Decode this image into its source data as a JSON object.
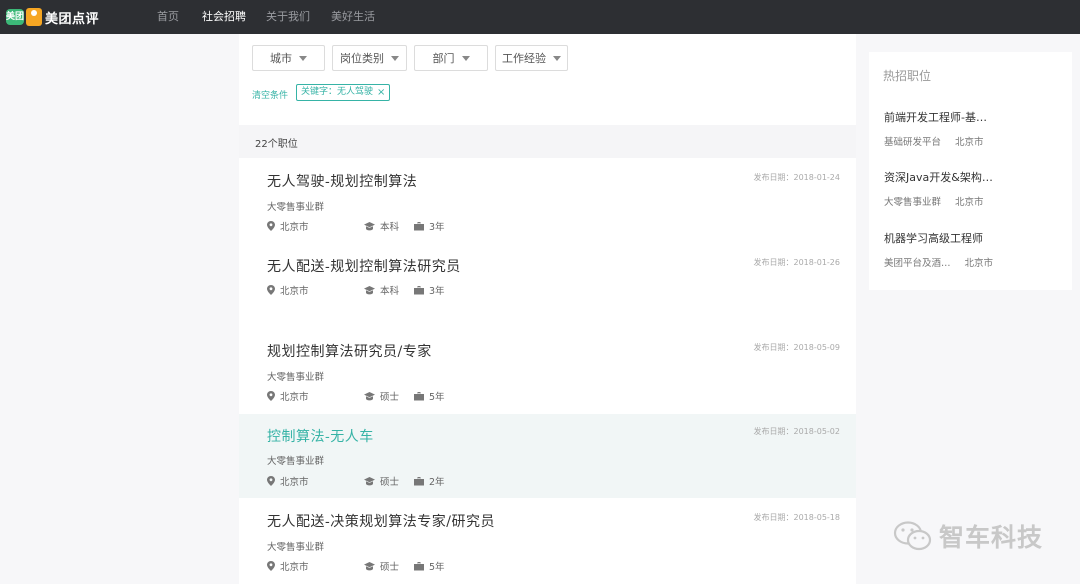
{
  "brand": {
    "badge": "美团",
    "name": "美团点评"
  },
  "nav": [
    "首页",
    "社会招聘",
    "关于我们",
    "美好生活"
  ],
  "filters": [
    "城市",
    "岗位类别",
    "部门",
    "工作经验"
  ],
  "clear_label": "清空条件",
  "keyword_tag": "关键字：无人驾驶",
  "tag_close": "×",
  "result_count": "22个职位",
  "jobs": [
    {
      "title": "无人驾驶-规划控制算法",
      "dept": "大零售事业群",
      "city": "北京市",
      "edu": "本科",
      "exp": "3年",
      "date": "发布日期：2018-01-24"
    },
    {
      "title": "无人配送-规划控制算法研究员",
      "dept": "",
      "city": "北京市",
      "edu": "本科",
      "exp": "3年",
      "date": "发布日期：2018-01-26"
    },
    {
      "title": "规划控制算法研究员/专家",
      "dept": "大零售事业群",
      "city": "北京市",
      "edu": "硕士",
      "exp": "5年",
      "date": "发布日期：2018-05-09"
    },
    {
      "title": "控制算法-无人车",
      "dept": "大零售事业群",
      "city": "北京市",
      "edu": "硕士",
      "exp": "2年",
      "date": "发布日期：2018-05-02"
    },
    {
      "title": "无人配送-决策规划算法专家/研究员",
      "dept": "大零售事业群",
      "city": "北京市",
      "edu": "硕士",
      "exp": "5年",
      "date": "发布日期：2018-05-18"
    }
  ],
  "sidebar": {
    "title": "热招职位",
    "items": [
      {
        "title": "前端开发工程师-基…",
        "dept": "基础研发平台",
        "city": "北京市"
      },
      {
        "title": "资深Java开发&架构…",
        "dept": "大零售事业群",
        "city": "北京市"
      },
      {
        "title": "机器学习高级工程师",
        "dept": "美团平台及酒…",
        "city": "北京市"
      }
    ]
  },
  "watermark": "智车科技",
  "colors": {
    "accent": "#36b3a6",
    "topbar": "#2d2f33",
    "logo_green": "#3cb878",
    "logo_orange": "#f6a623"
  },
  "icons": {
    "city": "location-pin-icon",
    "edu": "graduation-cap-icon",
    "exp": "briefcase-icon"
  }
}
